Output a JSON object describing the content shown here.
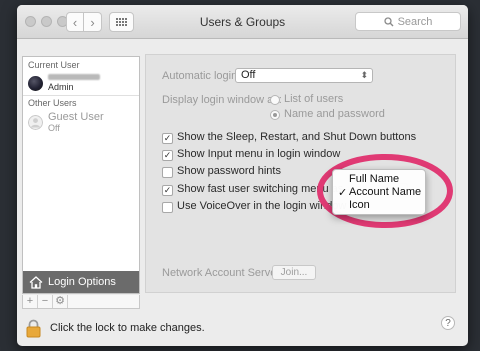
{
  "window": {
    "title": "Users & Groups",
    "search_placeholder": "Search"
  },
  "sidebar": {
    "current_user_label": "Current User",
    "current_user_role": "Admin",
    "other_users_label": "Other Users",
    "guest_user_name": "Guest User",
    "guest_user_status": "Off",
    "login_options_label": "Login Options"
  },
  "panel": {
    "automatic_login_label": "Automatic login:",
    "automatic_login_value": "Off",
    "display_login_window_label": "Display login window as:",
    "display_options": [
      {
        "label": "List of users",
        "selected": false
      },
      {
        "label": "Name and password",
        "selected": true
      }
    ],
    "checkbox_options": [
      {
        "label": "Show the Sleep, Restart, and Shut Down buttons",
        "checked": true
      },
      {
        "label": "Show Input menu in login window",
        "checked": true
      },
      {
        "label": "Show password hints",
        "checked": false
      },
      {
        "label": "Show fast user switching menu as",
        "checked": true
      },
      {
        "label": "Use VoiceOver in the login window",
        "checked": false
      }
    ],
    "network_account_label": "Network Account Server:",
    "join_button_label": "Join..."
  },
  "popup_menu": {
    "items": [
      {
        "label": "Full Name",
        "checked": false
      },
      {
        "label": "Account Name",
        "checked": true
      },
      {
        "label": "Icon",
        "checked": false
      }
    ],
    "check_glyph": "✓"
  },
  "footer": {
    "lock_text": "Click the lock to make changes.",
    "help_glyph": "?"
  },
  "colors": {
    "highlight_ring": "#e03a74",
    "login_options_bg": "#6b6b6b",
    "lock_color": "#e8a83a"
  },
  "icons": [
    "back-arrow-icon",
    "forward-arrow-icon",
    "grid-icon",
    "search-icon",
    "house-icon",
    "gear-icon",
    "lock-icon",
    "help-icon"
  ]
}
